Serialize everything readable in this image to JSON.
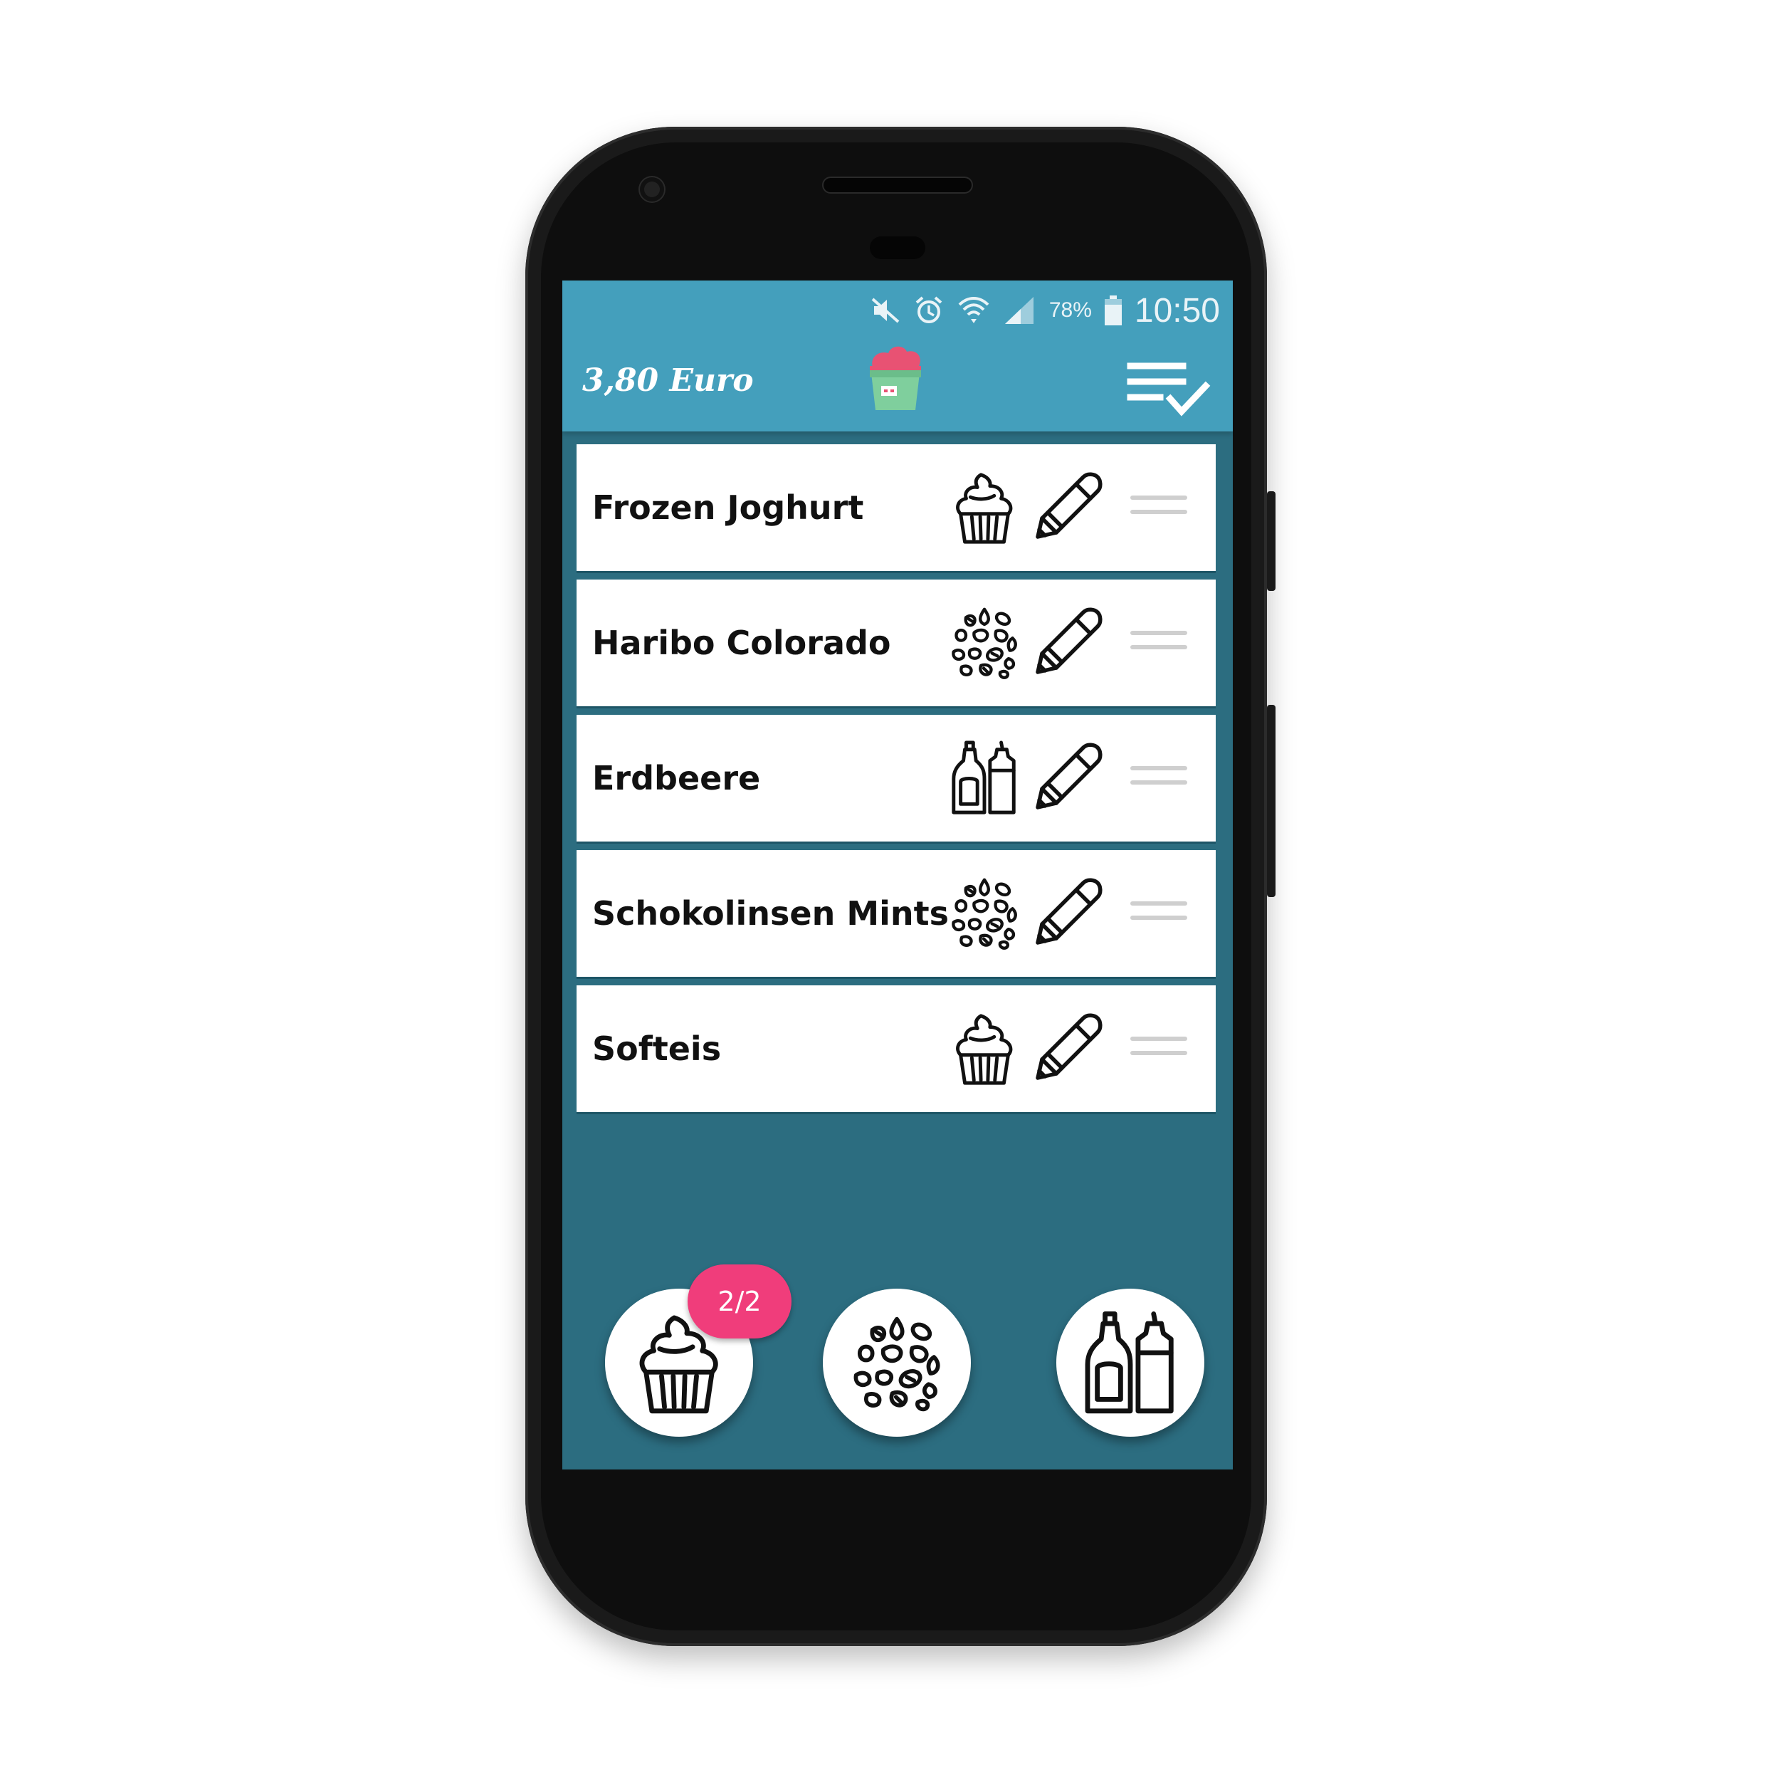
{
  "status_bar": {
    "icons": [
      "mute-icon",
      "alarm-icon",
      "wifi-icon",
      "signal-icon",
      "battery-icon"
    ],
    "battery": "78%",
    "time": "10:50"
  },
  "header": {
    "price": "3,80 Euro",
    "logo": "ice-cream-cup-logo",
    "action_icon": "checklist-icon"
  },
  "items": [
    {
      "name": "Frozen Joghurt",
      "category_icon": "cupcake-icon"
    },
    {
      "name": "Haribo Colorado",
      "category_icon": "candies-icon"
    },
    {
      "name": "Erdbeere",
      "category_icon": "sauce-bottles-icon"
    },
    {
      "name": "Schokolinsen Mints",
      "category_icon": "candies-icon"
    },
    {
      "name": "Softeis",
      "category_icon": "cupcake-icon"
    }
  ],
  "categories": [
    {
      "icon": "cupcake-icon",
      "badge": "2/2"
    },
    {
      "icon": "candies-icon"
    },
    {
      "icon": "sauce-bottles-icon"
    }
  ],
  "colors": {
    "appbar": "#449fbc",
    "background": "#2c6d80",
    "badge": "#f03d7b",
    "logo_top": "#e85273",
    "logo_cup": "#7fcf9d"
  }
}
